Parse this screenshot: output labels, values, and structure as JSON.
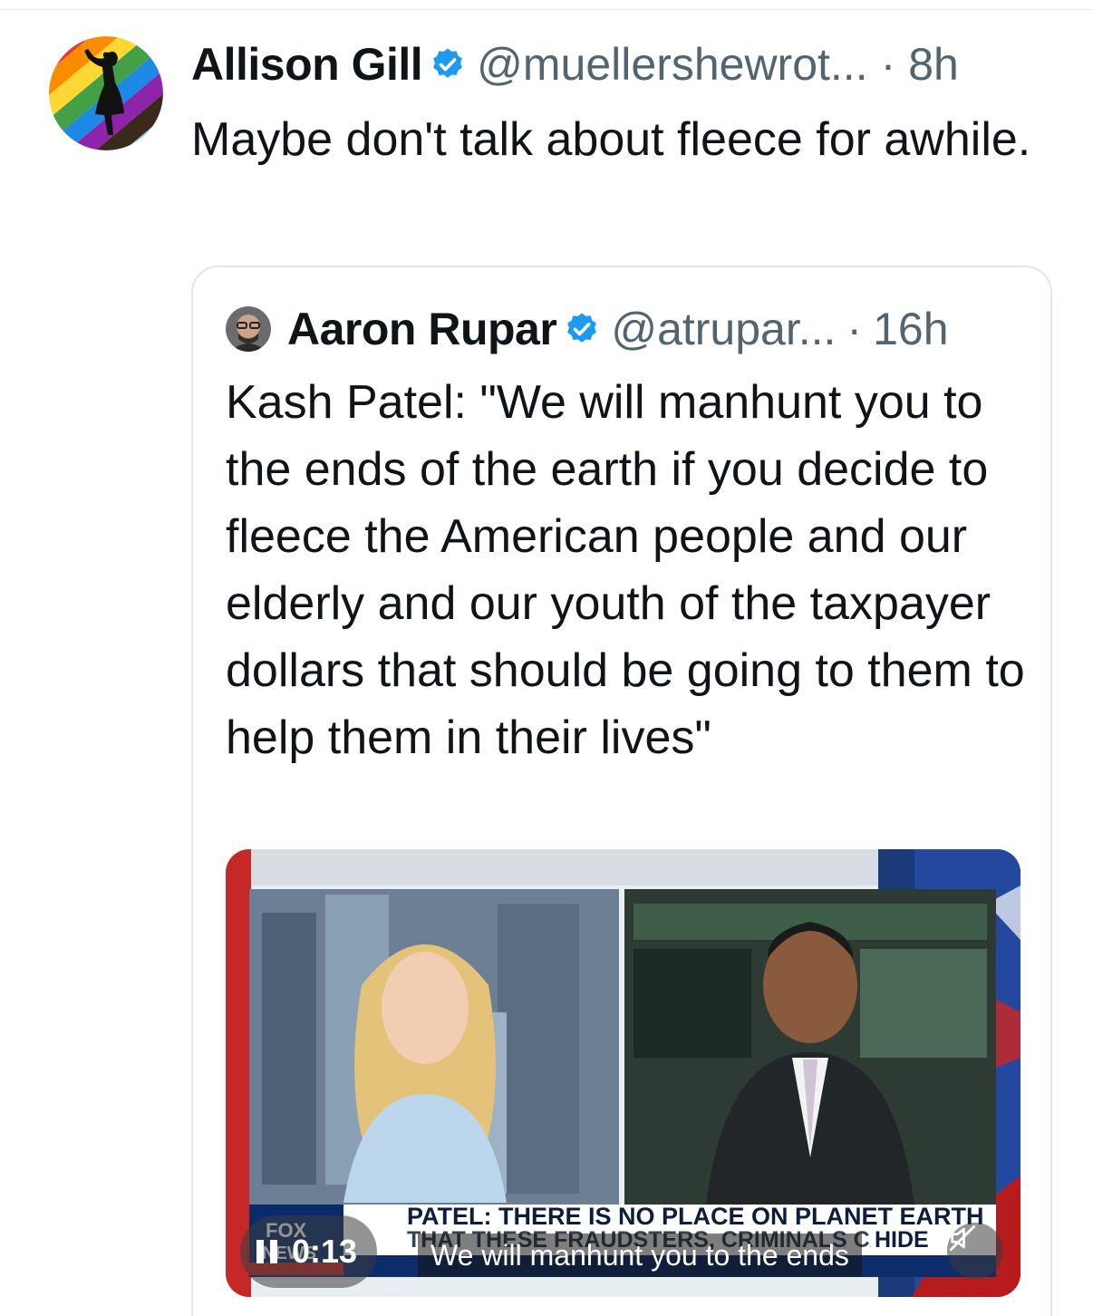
{
  "post": {
    "author_name": "Allison Gill",
    "handle": "@muellershewrot...",
    "separator": "·",
    "time": "8h",
    "text": "Maybe don't talk about fleece for awhile.",
    "verified_icon": "verified-badge-icon"
  },
  "quoted_post": {
    "author_name": "Aaron Rupar",
    "handle": "@atrupar...",
    "separator": "·",
    "time": "16h",
    "text": "Kash Patel: \"We will manhunt you to the ends of the earth if you decide to fleece the American people and our elderly and our youth of the taxpayer dollars that should be going to them to help them in their lives\"",
    "verified_icon": "verified-badge-icon"
  },
  "video": {
    "elapsed": "0:13",
    "caption": "We will manhunt you to the ends",
    "lower_third_line1": "PATEL: THERE IS NO PLACE ON PLANET EARTH",
    "lower_third_line2": "THAT THESE FRAUDSTERS, CRIMINALS CAN",
    "lower_third_hide": "HIDE",
    "pause_icon": "pause-icon",
    "mute_icon": "muted-speaker-icon",
    "network_logo": "FOX NEWS channel"
  },
  "colors": {
    "verified_blue": "#1d9bf0",
    "secondary_text": "#536471",
    "border": "#e1e6ea"
  }
}
